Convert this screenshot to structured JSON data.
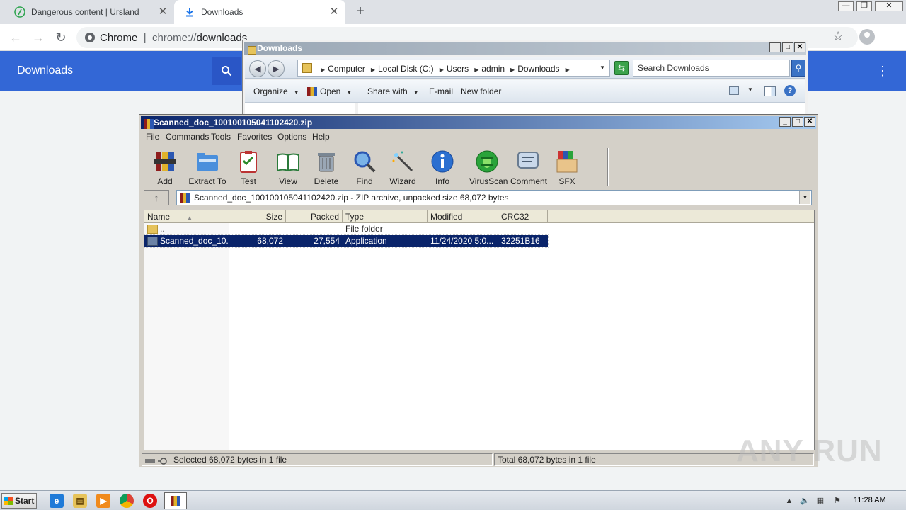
{
  "chrome": {
    "tabs": [
      {
        "title": "Dangerous content | Ursland",
        "close": "✕"
      },
      {
        "title": "Downloads",
        "close": "✕"
      }
    ],
    "new_tab": "+",
    "nav": {
      "back": "←",
      "forward": "→",
      "reload": "↻"
    },
    "omnibox": {
      "site": "Chrome",
      "separator": "|",
      "url_scheme": "chrome://",
      "url_path": "downloads"
    },
    "star": "☆",
    "window_controls": {
      "minimize": "—",
      "maximize": "❐",
      "close": "✕"
    }
  },
  "downloads_page": {
    "title": "Downloads",
    "search_icon": "search-icon",
    "menu_icon": "⋮"
  },
  "explorer": {
    "title": "Downloads",
    "breadcrumb": [
      "Computer",
      "Local Disk (C:)",
      "Users",
      "admin",
      "Downloads"
    ],
    "search_placeholder": "Search Downloads",
    "commands": {
      "organize": "Organize",
      "open": "Open",
      "share_with": "Share with",
      "email": "E-mail",
      "new_folder": "New folder"
    }
  },
  "winrar": {
    "title": "Scanned_doc_100100105041102420.zip",
    "menu": [
      "File",
      "Commands",
      "Tools",
      "Favorites",
      "Options",
      "Help"
    ],
    "toolbar": [
      "Add",
      "Extract To",
      "Test",
      "View",
      "Delete",
      "Find",
      "Wizard",
      "Info",
      "VirusScan",
      "Comment",
      "SFX"
    ],
    "path": "Scanned_doc_100100105041102420.zip - ZIP archive, unpacked size 68,072 bytes",
    "columns": [
      "Name",
      "Size",
      "Packed",
      "Type",
      "Modified",
      "CRC32"
    ],
    "rows": [
      {
        "name": "..",
        "size": "",
        "packed": "",
        "type": "File folder",
        "modified": "",
        "crc": ""
      },
      {
        "name": "Scanned_doc_10...",
        "size": "68,072",
        "packed": "27,554",
        "type": "Application",
        "modified": "11/24/2020 5:0...",
        "crc": "32251B16"
      }
    ],
    "status_left": "Selected 68,072 bytes in 1 file",
    "status_right": "Total 68,072 bytes in 1 file"
  },
  "watermark": "ANY RUN",
  "taskbar": {
    "start": "Start",
    "clock": "11:28 AM"
  }
}
